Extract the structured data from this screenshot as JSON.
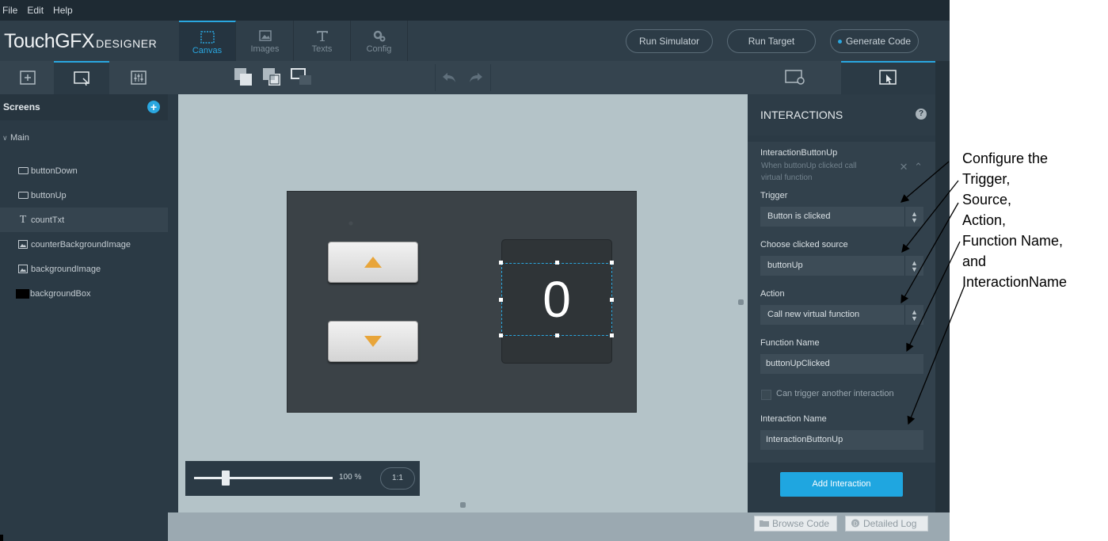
{
  "menu": [
    "File",
    "Edit",
    "Help"
  ],
  "logo": {
    "main": "TouchGFX",
    "sub": "DESIGNER"
  },
  "main_tabs": [
    {
      "label": "Canvas",
      "icon": "canvas-icon",
      "active": true
    },
    {
      "label": "Images",
      "icon": "image-icon",
      "active": false
    },
    {
      "label": "Texts",
      "icon": "text-icon",
      "active": false
    },
    {
      "label": "Config",
      "icon": "gears-icon",
      "active": false
    }
  ],
  "actions": {
    "run_simulator": "Run Simulator",
    "run_target": "Run Target",
    "generate_code": "Generate Code"
  },
  "left_panel": {
    "title": "Screens",
    "screen_name": "Main",
    "widgets": [
      {
        "label": "buttonDown",
        "icon": "button-icon"
      },
      {
        "label": "buttonUp",
        "icon": "button-icon"
      },
      {
        "label": "countTxt",
        "icon": "text-icon",
        "selected": true
      },
      {
        "label": "counterBackgroundImage",
        "icon": "image-icon"
      },
      {
        "label": "backgroundImage",
        "icon": "image-icon"
      },
      {
        "label": "backgroundBox",
        "icon": "box-icon"
      }
    ]
  },
  "canvas": {
    "counter_value": "0",
    "zoom_value": "100 %",
    "zoom_reset": "1:1"
  },
  "interactions": {
    "title": "INTERACTIONS",
    "help": "?",
    "name": "InteractionButtonUp",
    "description": "When buttonUp clicked call virtual function",
    "trigger_label": "Trigger",
    "trigger_value": "Button is clicked",
    "source_label": "Choose clicked source",
    "source_value": "buttonUp",
    "action_label": "Action",
    "action_value": "Call new virtual function",
    "function_label": "Function Name",
    "function_value": "buttonUpClicked",
    "can_trigger_label": "Can trigger another interaction",
    "can_trigger_checked": false,
    "interaction_name_label": "Interaction Name",
    "interaction_name_value": "InteractionButtonUp",
    "add_button": "Add Interaction"
  },
  "status_bar": {
    "browse_code": "Browse Code",
    "detailed_log": "Detailed Log"
  },
  "annotation_lines": [
    "Configure the",
    "Trigger,",
    "Source,",
    "Action,",
    "Function Name,",
    "and",
    "InteractionName"
  ],
  "colors": {
    "accent": "#2aa7e0",
    "panel": "#2b3a45",
    "canvas": "#b4c3c8",
    "arrow_icon": "#e8a53a"
  }
}
